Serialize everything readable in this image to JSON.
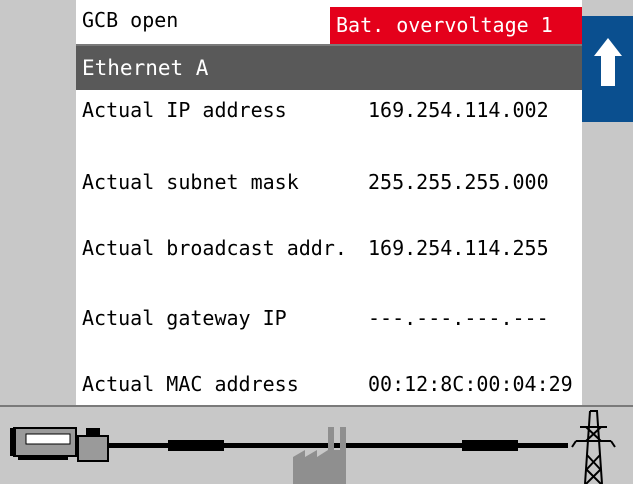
{
  "status": {
    "gcb": "GCB open",
    "alarm": "Bat. overvoltage 1"
  },
  "header": {
    "title": "Ethernet A"
  },
  "rows": [
    {
      "label": "Actual IP address",
      "value": "169.254.114.002"
    },
    {
      "label": "Actual subnet mask",
      "value": "255.255.255.000"
    },
    {
      "label": "Actual broadcast addr.",
      "value": "169.254.114.255"
    },
    {
      "label": "Actual gateway IP",
      "value": "---.---.---.---"
    },
    {
      "label": "Actual MAC address",
      "value": "00:12:8C:00:04:29"
    }
  ],
  "icons": {
    "back": "back-arrow-icon",
    "generator": "generator-icon",
    "load": "factory-icon",
    "mains": "power-pylon-icon"
  },
  "colors": {
    "alarm_bg": "#e4001b",
    "header_bg": "#595959",
    "back_button_bg": "#0a4f8f"
  }
}
